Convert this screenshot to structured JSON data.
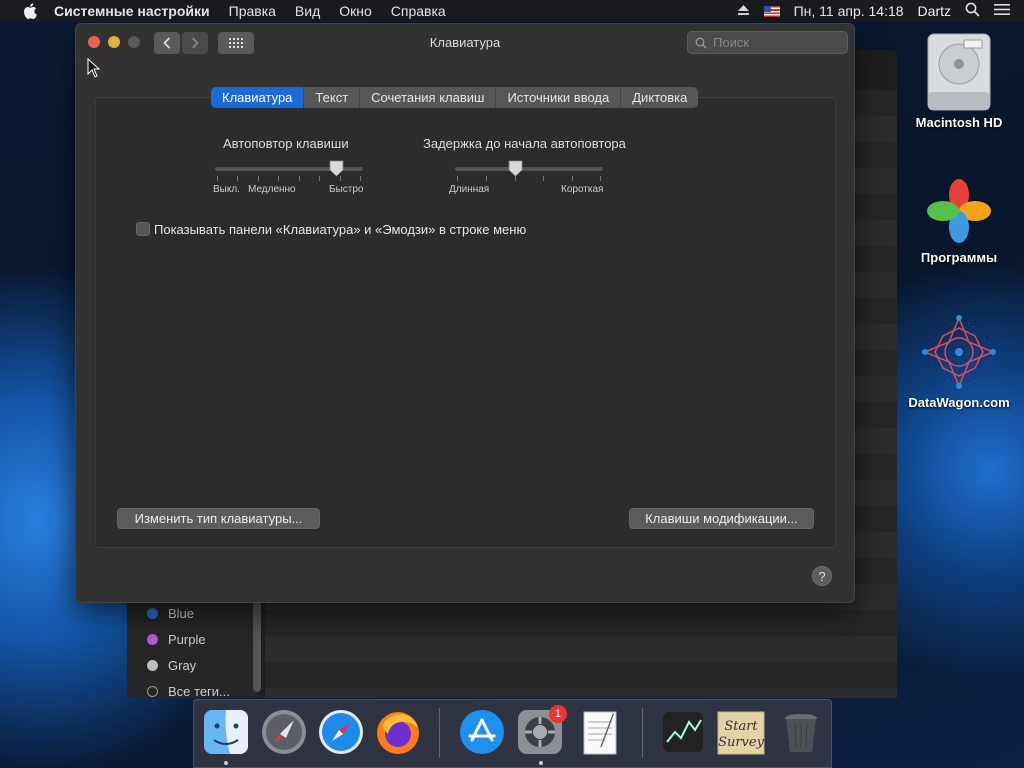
{
  "menubar": {
    "app": "Системные настройки",
    "items": [
      "Правка",
      "Вид",
      "Окно",
      "Справка"
    ],
    "datetime": "Пн, 11 апр. 14:18",
    "user": "Dartz"
  },
  "window": {
    "title": "Клавиатура",
    "search_placeholder": "Поиск",
    "tabs": [
      "Клавиатура",
      "Текст",
      "Сочетания клавиш",
      "Источники ввода",
      "Диктовка"
    ],
    "active_tab": "Клавиатура",
    "key_repeat": {
      "label": "Автоповтор клавиши",
      "ticks": [
        "Выкл.",
        "Медленно",
        "Быстро"
      ],
      "value": 0.82
    },
    "repeat_delay": {
      "label": "Задержка до начала автоповтора",
      "ticks": [
        "Длинная",
        "Короткая"
      ],
      "value": 0.4
    },
    "show_menu_checkbox": {
      "label": "Показывать панели «Клавиатура» и «Эмодзи» в строке меню",
      "checked": false
    },
    "change_keyboard_type_button": "Изменить тип клавиатуры...",
    "modifier_keys_button": "Клавиши модификации...",
    "help": "?"
  },
  "background_window": {
    "tags": [
      {
        "name": "Blue",
        "color": "#2f6fd6"
      },
      {
        "name": "Purple",
        "color": "#b05ad8"
      },
      {
        "name": "Gray",
        "color": "#9a9a9a"
      },
      {
        "name": "Все теги...",
        "color": "transparent"
      }
    ]
  },
  "desktop": {
    "icons": [
      "Macintosh HD",
      "Программы",
      "DataWagon.com"
    ]
  },
  "dock": {
    "items": [
      "finder-icon",
      "launchpad-icon",
      "safari-icon",
      "firefox-icon",
      "app-store-icon",
      "system-preferences-icon",
      "textedit-icon",
      "stocks-icon",
      "start-survey-note",
      "trash-icon"
    ],
    "system_preferences_badge": "1",
    "start_survey_text": "Start Survey"
  },
  "colors": {
    "accent": "#1a6ad8",
    "close": "#ec5f57",
    "minimize": "#e0b13e",
    "zoom": "#5a5a5a"
  }
}
